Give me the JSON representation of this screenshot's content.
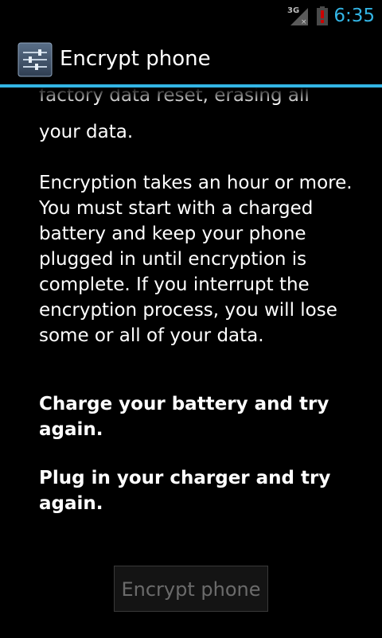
{
  "status_bar": {
    "network_label": "3G",
    "time": "6:35",
    "accent_color": "#33b5e5",
    "battery_alert_color": "#cc0000",
    "icons": [
      "signal-icon",
      "battery-alert-icon"
    ]
  },
  "action_bar": {
    "title": "Encrypt phone",
    "icon": "settings-icon",
    "divider_color": "#33b5e5"
  },
  "content": {
    "clipped_line": "factory data reset, erasing all",
    "intro_tail": "your data.",
    "duration_text": "Encryption takes an hour or more. You must start with a charged battery and keep your phone plugged in until encryption is complete. If you interrupt the encryption process, you will lose some or all of your data.",
    "battery_warning": "Charge your battery and try again.",
    "charger_warning": "Plug in your charger and try again."
  },
  "button": {
    "label": "Encrypt phone",
    "enabled": false
  }
}
